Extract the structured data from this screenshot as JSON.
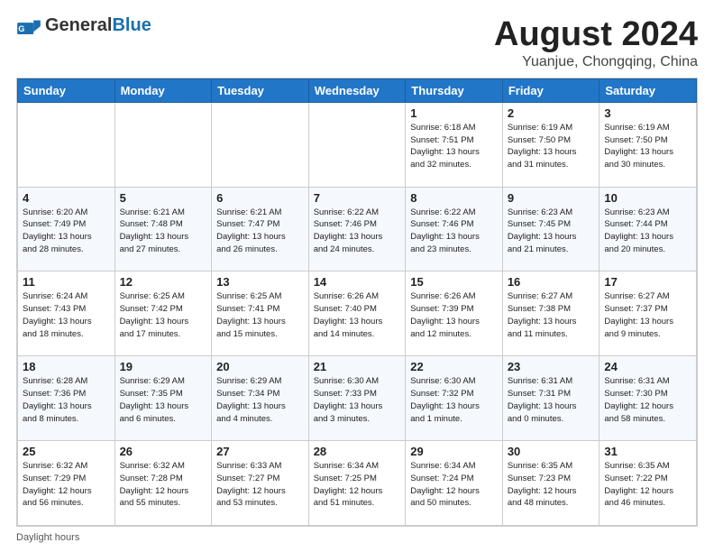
{
  "header": {
    "logo_general": "General",
    "logo_blue": "Blue",
    "month_title": "August 2024",
    "subtitle": "Yuanjue, Chongqing, China"
  },
  "weekdays": [
    "Sunday",
    "Monday",
    "Tuesday",
    "Wednesday",
    "Thursday",
    "Friday",
    "Saturday"
  ],
  "footer": {
    "daylight_label": "Daylight hours"
  },
  "weeks": [
    [
      {
        "day": "",
        "info": ""
      },
      {
        "day": "",
        "info": ""
      },
      {
        "day": "",
        "info": ""
      },
      {
        "day": "",
        "info": ""
      },
      {
        "day": "1",
        "info": "Sunrise: 6:18 AM\nSunset: 7:51 PM\nDaylight: 13 hours\nand 32 minutes."
      },
      {
        "day": "2",
        "info": "Sunrise: 6:19 AM\nSunset: 7:50 PM\nDaylight: 13 hours\nand 31 minutes."
      },
      {
        "day": "3",
        "info": "Sunrise: 6:19 AM\nSunset: 7:50 PM\nDaylight: 13 hours\nand 30 minutes."
      }
    ],
    [
      {
        "day": "4",
        "info": "Sunrise: 6:20 AM\nSunset: 7:49 PM\nDaylight: 13 hours\nand 28 minutes."
      },
      {
        "day": "5",
        "info": "Sunrise: 6:21 AM\nSunset: 7:48 PM\nDaylight: 13 hours\nand 27 minutes."
      },
      {
        "day": "6",
        "info": "Sunrise: 6:21 AM\nSunset: 7:47 PM\nDaylight: 13 hours\nand 26 minutes."
      },
      {
        "day": "7",
        "info": "Sunrise: 6:22 AM\nSunset: 7:46 PM\nDaylight: 13 hours\nand 24 minutes."
      },
      {
        "day": "8",
        "info": "Sunrise: 6:22 AM\nSunset: 7:46 PM\nDaylight: 13 hours\nand 23 minutes."
      },
      {
        "day": "9",
        "info": "Sunrise: 6:23 AM\nSunset: 7:45 PM\nDaylight: 13 hours\nand 21 minutes."
      },
      {
        "day": "10",
        "info": "Sunrise: 6:23 AM\nSunset: 7:44 PM\nDaylight: 13 hours\nand 20 minutes."
      }
    ],
    [
      {
        "day": "11",
        "info": "Sunrise: 6:24 AM\nSunset: 7:43 PM\nDaylight: 13 hours\nand 18 minutes."
      },
      {
        "day": "12",
        "info": "Sunrise: 6:25 AM\nSunset: 7:42 PM\nDaylight: 13 hours\nand 17 minutes."
      },
      {
        "day": "13",
        "info": "Sunrise: 6:25 AM\nSunset: 7:41 PM\nDaylight: 13 hours\nand 15 minutes."
      },
      {
        "day": "14",
        "info": "Sunrise: 6:26 AM\nSunset: 7:40 PM\nDaylight: 13 hours\nand 14 minutes."
      },
      {
        "day": "15",
        "info": "Sunrise: 6:26 AM\nSunset: 7:39 PM\nDaylight: 13 hours\nand 12 minutes."
      },
      {
        "day": "16",
        "info": "Sunrise: 6:27 AM\nSunset: 7:38 PM\nDaylight: 13 hours\nand 11 minutes."
      },
      {
        "day": "17",
        "info": "Sunrise: 6:27 AM\nSunset: 7:37 PM\nDaylight: 13 hours\nand 9 minutes."
      }
    ],
    [
      {
        "day": "18",
        "info": "Sunrise: 6:28 AM\nSunset: 7:36 PM\nDaylight: 13 hours\nand 8 minutes."
      },
      {
        "day": "19",
        "info": "Sunrise: 6:29 AM\nSunset: 7:35 PM\nDaylight: 13 hours\nand 6 minutes."
      },
      {
        "day": "20",
        "info": "Sunrise: 6:29 AM\nSunset: 7:34 PM\nDaylight: 13 hours\nand 4 minutes."
      },
      {
        "day": "21",
        "info": "Sunrise: 6:30 AM\nSunset: 7:33 PM\nDaylight: 13 hours\nand 3 minutes."
      },
      {
        "day": "22",
        "info": "Sunrise: 6:30 AM\nSunset: 7:32 PM\nDaylight: 13 hours\nand 1 minute."
      },
      {
        "day": "23",
        "info": "Sunrise: 6:31 AM\nSunset: 7:31 PM\nDaylight: 13 hours\nand 0 minutes."
      },
      {
        "day": "24",
        "info": "Sunrise: 6:31 AM\nSunset: 7:30 PM\nDaylight: 12 hours\nand 58 minutes."
      }
    ],
    [
      {
        "day": "25",
        "info": "Sunrise: 6:32 AM\nSunset: 7:29 PM\nDaylight: 12 hours\nand 56 minutes."
      },
      {
        "day": "26",
        "info": "Sunrise: 6:32 AM\nSunset: 7:28 PM\nDaylight: 12 hours\nand 55 minutes."
      },
      {
        "day": "27",
        "info": "Sunrise: 6:33 AM\nSunset: 7:27 PM\nDaylight: 12 hours\nand 53 minutes."
      },
      {
        "day": "28",
        "info": "Sunrise: 6:34 AM\nSunset: 7:25 PM\nDaylight: 12 hours\nand 51 minutes."
      },
      {
        "day": "29",
        "info": "Sunrise: 6:34 AM\nSunset: 7:24 PM\nDaylight: 12 hours\nand 50 minutes."
      },
      {
        "day": "30",
        "info": "Sunrise: 6:35 AM\nSunset: 7:23 PM\nDaylight: 12 hours\nand 48 minutes."
      },
      {
        "day": "31",
        "info": "Sunrise: 6:35 AM\nSunset: 7:22 PM\nDaylight: 12 hours\nand 46 minutes."
      }
    ]
  ]
}
